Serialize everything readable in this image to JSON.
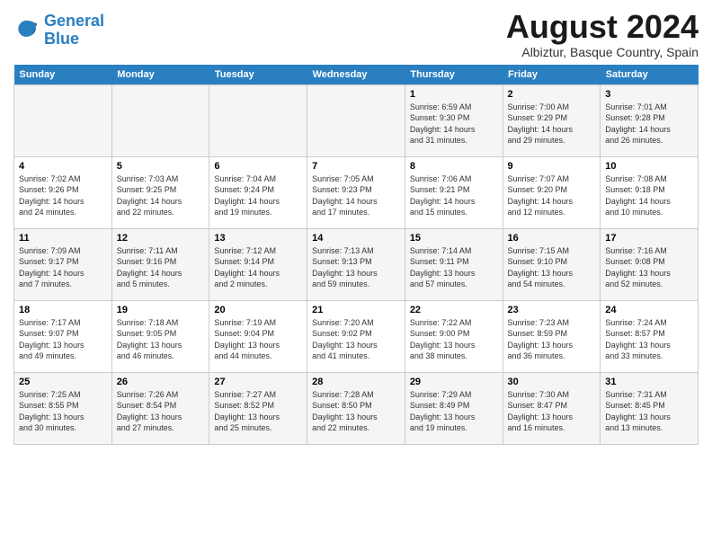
{
  "header": {
    "logo_line1": "General",
    "logo_line2": "Blue",
    "month_title": "August 2024",
    "subtitle": "Albiztur, Basque Country, Spain"
  },
  "weekdays": [
    "Sunday",
    "Monday",
    "Tuesday",
    "Wednesday",
    "Thursday",
    "Friday",
    "Saturday"
  ],
  "weeks": [
    [
      {
        "day": "",
        "info": ""
      },
      {
        "day": "",
        "info": ""
      },
      {
        "day": "",
        "info": ""
      },
      {
        "day": "",
        "info": ""
      },
      {
        "day": "1",
        "info": "Sunrise: 6:59 AM\nSunset: 9:30 PM\nDaylight: 14 hours\nand 31 minutes."
      },
      {
        "day": "2",
        "info": "Sunrise: 7:00 AM\nSunset: 9:29 PM\nDaylight: 14 hours\nand 29 minutes."
      },
      {
        "day": "3",
        "info": "Sunrise: 7:01 AM\nSunset: 9:28 PM\nDaylight: 14 hours\nand 26 minutes."
      }
    ],
    [
      {
        "day": "4",
        "info": "Sunrise: 7:02 AM\nSunset: 9:26 PM\nDaylight: 14 hours\nand 24 minutes."
      },
      {
        "day": "5",
        "info": "Sunrise: 7:03 AM\nSunset: 9:25 PM\nDaylight: 14 hours\nand 22 minutes."
      },
      {
        "day": "6",
        "info": "Sunrise: 7:04 AM\nSunset: 9:24 PM\nDaylight: 14 hours\nand 19 minutes."
      },
      {
        "day": "7",
        "info": "Sunrise: 7:05 AM\nSunset: 9:23 PM\nDaylight: 14 hours\nand 17 minutes."
      },
      {
        "day": "8",
        "info": "Sunrise: 7:06 AM\nSunset: 9:21 PM\nDaylight: 14 hours\nand 15 minutes."
      },
      {
        "day": "9",
        "info": "Sunrise: 7:07 AM\nSunset: 9:20 PM\nDaylight: 14 hours\nand 12 minutes."
      },
      {
        "day": "10",
        "info": "Sunrise: 7:08 AM\nSunset: 9:18 PM\nDaylight: 14 hours\nand 10 minutes."
      }
    ],
    [
      {
        "day": "11",
        "info": "Sunrise: 7:09 AM\nSunset: 9:17 PM\nDaylight: 14 hours\nand 7 minutes."
      },
      {
        "day": "12",
        "info": "Sunrise: 7:11 AM\nSunset: 9:16 PM\nDaylight: 14 hours\nand 5 minutes."
      },
      {
        "day": "13",
        "info": "Sunrise: 7:12 AM\nSunset: 9:14 PM\nDaylight: 14 hours\nand 2 minutes."
      },
      {
        "day": "14",
        "info": "Sunrise: 7:13 AM\nSunset: 9:13 PM\nDaylight: 13 hours\nand 59 minutes."
      },
      {
        "day": "15",
        "info": "Sunrise: 7:14 AM\nSunset: 9:11 PM\nDaylight: 13 hours\nand 57 minutes."
      },
      {
        "day": "16",
        "info": "Sunrise: 7:15 AM\nSunset: 9:10 PM\nDaylight: 13 hours\nand 54 minutes."
      },
      {
        "day": "17",
        "info": "Sunrise: 7:16 AM\nSunset: 9:08 PM\nDaylight: 13 hours\nand 52 minutes."
      }
    ],
    [
      {
        "day": "18",
        "info": "Sunrise: 7:17 AM\nSunset: 9:07 PM\nDaylight: 13 hours\nand 49 minutes."
      },
      {
        "day": "19",
        "info": "Sunrise: 7:18 AM\nSunset: 9:05 PM\nDaylight: 13 hours\nand 46 minutes."
      },
      {
        "day": "20",
        "info": "Sunrise: 7:19 AM\nSunset: 9:04 PM\nDaylight: 13 hours\nand 44 minutes."
      },
      {
        "day": "21",
        "info": "Sunrise: 7:20 AM\nSunset: 9:02 PM\nDaylight: 13 hours\nand 41 minutes."
      },
      {
        "day": "22",
        "info": "Sunrise: 7:22 AM\nSunset: 9:00 PM\nDaylight: 13 hours\nand 38 minutes."
      },
      {
        "day": "23",
        "info": "Sunrise: 7:23 AM\nSunset: 8:59 PM\nDaylight: 13 hours\nand 36 minutes."
      },
      {
        "day": "24",
        "info": "Sunrise: 7:24 AM\nSunset: 8:57 PM\nDaylight: 13 hours\nand 33 minutes."
      }
    ],
    [
      {
        "day": "25",
        "info": "Sunrise: 7:25 AM\nSunset: 8:55 PM\nDaylight: 13 hours\nand 30 minutes."
      },
      {
        "day": "26",
        "info": "Sunrise: 7:26 AM\nSunset: 8:54 PM\nDaylight: 13 hours\nand 27 minutes."
      },
      {
        "day": "27",
        "info": "Sunrise: 7:27 AM\nSunset: 8:52 PM\nDaylight: 13 hours\nand 25 minutes."
      },
      {
        "day": "28",
        "info": "Sunrise: 7:28 AM\nSunset: 8:50 PM\nDaylight: 13 hours\nand 22 minutes."
      },
      {
        "day": "29",
        "info": "Sunrise: 7:29 AM\nSunset: 8:49 PM\nDaylight: 13 hours\nand 19 minutes."
      },
      {
        "day": "30",
        "info": "Sunrise: 7:30 AM\nSunset: 8:47 PM\nDaylight: 13 hours\nand 16 minutes."
      },
      {
        "day": "31",
        "info": "Sunrise: 7:31 AM\nSunset: 8:45 PM\nDaylight: 13 hours\nand 13 minutes."
      }
    ]
  ]
}
